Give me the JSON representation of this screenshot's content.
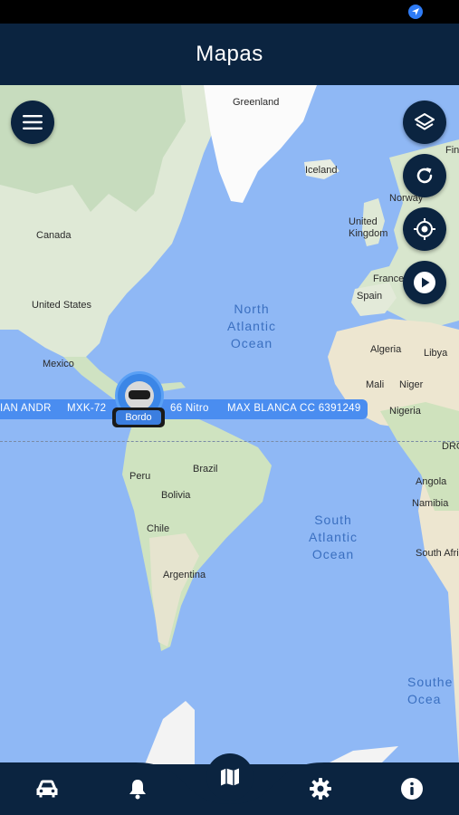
{
  "header": {
    "title": "Mapas"
  },
  "map": {
    "places": {
      "greenland": "Greenland",
      "iceland": "Iceland",
      "canada": "Canada",
      "united_states": "United States",
      "mexico": "Mexico",
      "united_kingdom": "United\nKingdom",
      "norway": "Norway",
      "finland": "Fin",
      "france": "France",
      "spain": "Spain",
      "algeria": "Algeria",
      "libya": "Libya",
      "mali": "Mali",
      "niger": "Niger",
      "nigeria": "Nigeria",
      "drc": "DRC",
      "angola": "Angola",
      "namibia": "Namibia",
      "south_africa": "South Afri",
      "peru": "Peru",
      "brazil": "Brazil",
      "bolivia": "Bolivia",
      "chile": "Chile",
      "argentina": "Argentina"
    },
    "oceans": {
      "north_atlantic": "North\nAtlantic\nOcean",
      "south_atlantic": "South\nAtlantic\nOcean",
      "southern": "Southe\nOcea"
    },
    "vehicles": {
      "label_1": "IAN ANDR",
      "label_2": "MXK-72",
      "label_3": "66 Nitro",
      "label_4": "MAX BLANCA CC 6391249",
      "selected": "Bordo"
    },
    "controls": {
      "menu": "menu-icon",
      "layers": "layers-icon",
      "refresh": "refresh-icon",
      "locate": "locate-icon",
      "play": "play-icon"
    }
  },
  "bottom_nav": {
    "items": [
      "car-icon",
      "bell-icon",
      "map-icon",
      "gear-icon",
      "info-icon"
    ],
    "active": "map-icon"
  },
  "colors": {
    "primary": "#0b2440",
    "ocean": "#8fb8f5",
    "land": "#dfe9d6",
    "accent": "#4a8df0"
  }
}
